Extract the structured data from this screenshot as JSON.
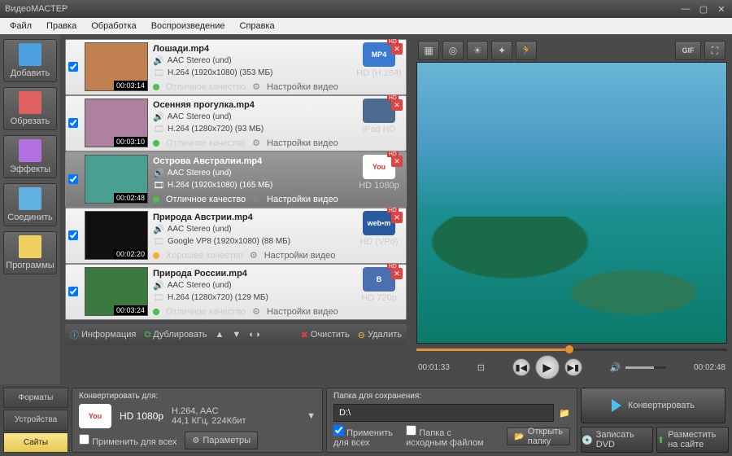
{
  "title": "ВидеоМАСТЕР",
  "menu": [
    "Файл",
    "Правка",
    "Обработка",
    "Воспроизведение",
    "Справка"
  ],
  "sidebar": [
    {
      "label": "Добавить",
      "color": "#4aa0e0"
    },
    {
      "label": "Обрезать",
      "color": "#e06060"
    },
    {
      "label": "Эффекты",
      "color": "#b070e0"
    },
    {
      "label": "Соединить",
      "color": "#60b0e0"
    },
    {
      "label": "Программы",
      "color": "#f0d060"
    }
  ],
  "files": [
    {
      "name": "Лошади.mp4",
      "dur": "00:03:14",
      "audio": "AAC Stereo (und)",
      "video": "H.264 (1920x1080) (353 МБ)",
      "quality": "Отличное качество",
      "qcolor": "#4ac050",
      "settings": "Настройки видео",
      "fmt": "MP4",
      "fmtlabel": "HD (H.264)",
      "fmtbg": "#3a7ad0",
      "thumb": "#c08050",
      "sel": false
    },
    {
      "name": "Осенняя прогулка.mp4",
      "dur": "00:03:10",
      "audio": "AAC Stereo (und)",
      "video": "H.264 (1280x720) (93 МБ)",
      "quality": "Отличное качество",
      "qcolor": "#4ac050",
      "settings": "Настройки видео",
      "fmt": "",
      "fmtlabel": "iPad HD",
      "fmtbg": "#4a6a90",
      "thumb": "#b080a0",
      "sel": false
    },
    {
      "name": "Острова Австралии.mp4",
      "dur": "00:02:48",
      "audio": "AAC Stereo (und)",
      "video": "H.264 (1920x1080) (165 МБ)",
      "quality": "Отличное качество",
      "qcolor": "#4ac050",
      "settings": "Настройки видео",
      "fmt": "You",
      "fmtlabel": "HD 1080p",
      "fmtbg": "#ffffff",
      "thumb": "#4aa090",
      "sel": true
    },
    {
      "name": "Природа Австрии.mp4",
      "dur": "00:02:20",
      "audio": "AAC Stereo (und)",
      "video": "Google VP8 (1920x1080) (88 МБ)",
      "quality": "Хорошее качество",
      "qcolor": "#f0b030",
      "settings": "Настройки видео",
      "fmt": "web•m",
      "fmtlabel": "HD (VP8)",
      "fmtbg": "#2a5aa0",
      "thumb": "#101010",
      "sel": false
    },
    {
      "name": "Природа России.mp4",
      "dur": "00:03:24",
      "audio": "AAC Stereo (und)",
      "video": "H.264 (1280x720) (129 МБ)",
      "quality": "Отличное качество",
      "qcolor": "#4ac050",
      "settings": "Настройки видео",
      "fmt": "B",
      "fmtlabel": "HD 720p",
      "fmtbg": "#4a70b0",
      "thumb": "#3a7a40",
      "sel": false
    }
  ],
  "listbar": {
    "info": "Информация",
    "dup": "Дублировать",
    "clear": "Очистить",
    "del": "Удалить"
  },
  "player": {
    "cur": "00:01:33",
    "total": "00:02:48"
  },
  "bottom": {
    "tabs": [
      "Форматы",
      "Устройства",
      "Сайты"
    ],
    "convert_for": "Конвертировать для:",
    "fmt_name": "HD 1080p",
    "fmt_codec": "H.264, AAC",
    "fmt_rate": "44,1 КГц, 224Кбит",
    "apply_all": "Применить для всех",
    "params": "Параметры",
    "save_folder": "Папка для сохранения:",
    "path": "D:\\",
    "folder_src": "Папка с исходным файлом",
    "open_folder": "Открыть папку",
    "convert": "Конвертировать",
    "burn": "Записать DVD",
    "publish": "Разместить на сайте"
  }
}
